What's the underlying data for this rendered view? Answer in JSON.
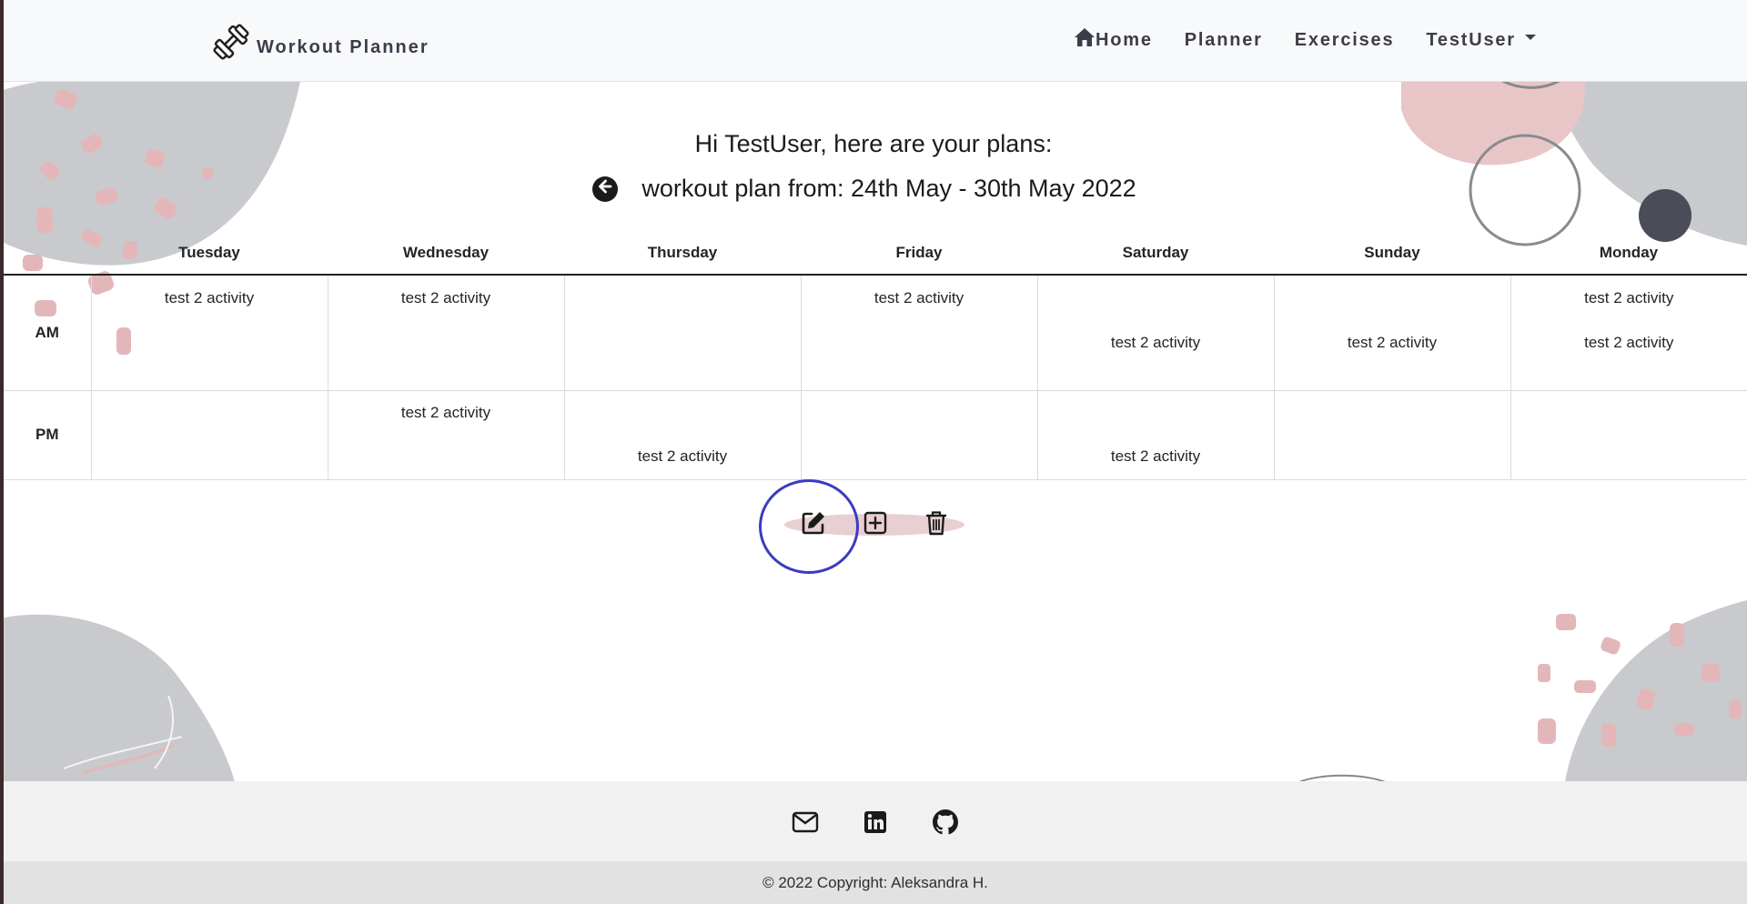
{
  "navbar": {
    "brand_icon": "dumbbell-icon",
    "brand_label": "Workout Planner",
    "links": [
      {
        "label": "Home",
        "icon": "home-icon"
      },
      {
        "label": "Planner"
      },
      {
        "label": "Exercises"
      },
      {
        "label": "TestUser",
        "icon": "caret-down-icon"
      }
    ]
  },
  "main": {
    "greeting": "Hi TestUser, here are your plans:",
    "back_icon": "arrow-left-circle-icon",
    "plan_title": "workout plan from: 24th May - 30th May 2022"
  },
  "table": {
    "days": [
      "Tuesday",
      "Wednesday",
      "Thursday",
      "Friday",
      "Saturday",
      "Sunday",
      "Monday"
    ],
    "rows": [
      {
        "period": "AM",
        "cells": [
          [
            "test 2 activity",
            ""
          ],
          [
            "test 2 activity",
            ""
          ],
          [
            "",
            ""
          ],
          [
            "test 2 activity",
            ""
          ],
          [
            "",
            "test 2 activity"
          ],
          [
            "",
            "test 2 activity"
          ],
          [
            "test 2 activity",
            "test 2 activity"
          ]
        ]
      },
      {
        "period": "PM",
        "cells": [
          [
            "",
            ""
          ],
          [
            "test 2 activity",
            ""
          ],
          [
            "",
            "test 2 activity"
          ],
          [
            "",
            ""
          ],
          [
            "",
            "test 2 activity"
          ],
          [
            "",
            ""
          ],
          [
            "",
            ""
          ]
        ]
      }
    ]
  },
  "actions": {
    "edit_icon": "edit-icon",
    "add_icon": "plus-square-icon",
    "delete_icon": "trash-icon"
  },
  "footer": {
    "icons": [
      "mail-icon",
      "linkedin-icon",
      "github-icon"
    ],
    "copyright": "© 2022 Copyright: Aleksandra H."
  },
  "colors": {
    "navbar_bg": "#f8f9fa",
    "text_dark": "#3d3d4a",
    "blob_grey": "#c9cacd",
    "blob_pink": "#e8c6c8",
    "focus_ring": "#3b3bc2",
    "footer_bg": "#f1f1f1",
    "copyright_bg": "#e2e2e2"
  }
}
